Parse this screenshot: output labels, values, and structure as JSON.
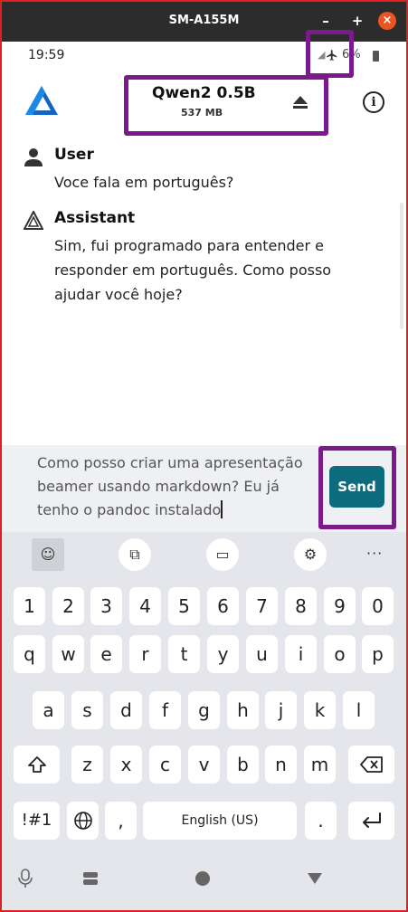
{
  "window": {
    "title": "SM-A155M",
    "minimize": "–",
    "maximize": "+",
    "close": "×"
  },
  "status": {
    "time": "19:59",
    "battery": "6%"
  },
  "header": {
    "model_name": "Qwen2 0.5B",
    "model_size": "537 MB",
    "info": "i"
  },
  "messages": [
    {
      "role": "User",
      "text": "Voce fala em português?"
    },
    {
      "role": "Assistant",
      "text": "Sim, fui programado para entender e responder em português. Como posso ajudar você hoje?"
    }
  ],
  "input": {
    "value": "Como posso criar uma apresentação beamer usando markdown? Eu já tenho o pandoc instalado",
    "send_label": "Send"
  },
  "keyboard": {
    "toolbar_more": "···",
    "row_numbers": [
      "1",
      "2",
      "3",
      "4",
      "5",
      "6",
      "7",
      "8",
      "9",
      "0"
    ],
    "row1": [
      "q",
      "w",
      "e",
      "r",
      "t",
      "y",
      "u",
      "i",
      "o",
      "p"
    ],
    "row2": [
      "a",
      "s",
      "d",
      "f",
      "g",
      "h",
      "j",
      "k",
      "l"
    ],
    "row3": [
      "z",
      "x",
      "c",
      "v",
      "b",
      "n",
      "m"
    ],
    "symbols_key": "!#1",
    "comma_key": ",",
    "period_key": ".",
    "space_label": "English (US)"
  },
  "colors": {
    "send_button": "#0d6b7e",
    "highlight": "#7b1a8b",
    "window_close": "#e95420",
    "frame": "#e02020"
  }
}
